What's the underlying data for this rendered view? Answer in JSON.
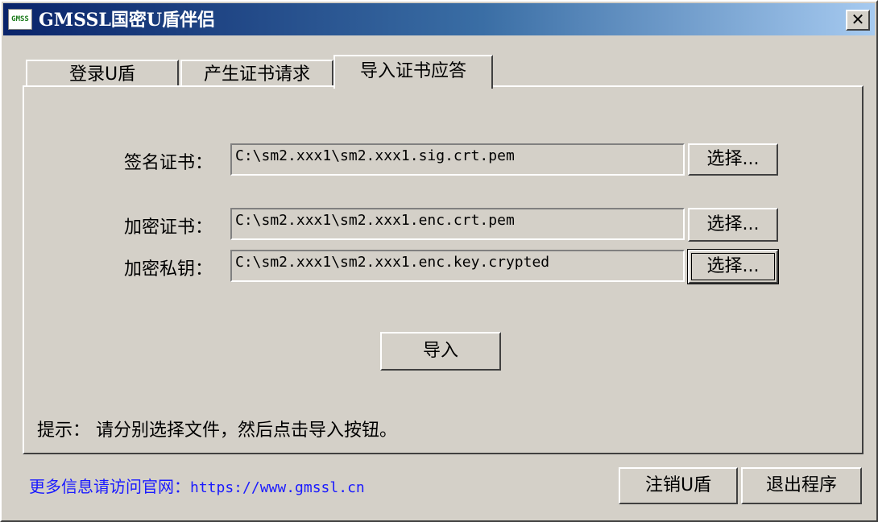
{
  "window": {
    "title": "GMSSL国密U盾伴侣",
    "icon_name": "app-logo-icon",
    "icon_text": "GMSS",
    "close_glyph": "✕"
  },
  "tabs": [
    {
      "label": "登录U盾",
      "active": false
    },
    {
      "label": "产生证书请求",
      "active": false
    },
    {
      "label": "导入证书应答",
      "active": true
    }
  ],
  "form": {
    "sign_cert": {
      "label": "签名证书：",
      "value": "C:\\sm2.xxx1\\sm2.xxx1.sig.crt.pem",
      "button": "选择..."
    },
    "enc_cert": {
      "label": "加密证书：",
      "value": "C:\\sm2.xxx1\\sm2.xxx1.enc.crt.pem",
      "button": "选择..."
    },
    "enc_key": {
      "label": "加密私钥：",
      "value": "C:\\sm2.xxx1\\sm2.xxx1.enc.key.crypted",
      "button": "选择..."
    },
    "import_button": "导入",
    "hint": "提示： 请分别选择文件，然后点击导入按钮。"
  },
  "footer": {
    "info_label": "更多信息请访问官网：",
    "url": "https://www.gmssl.cn",
    "logout_button": "注销U盾",
    "exit_button": "退出程序"
  },
  "colors": {
    "titlebar_start": "#0a246a",
    "titlebar_end": "#a6caf0",
    "face": "#d4d0c8",
    "link": "#1a1aff"
  }
}
